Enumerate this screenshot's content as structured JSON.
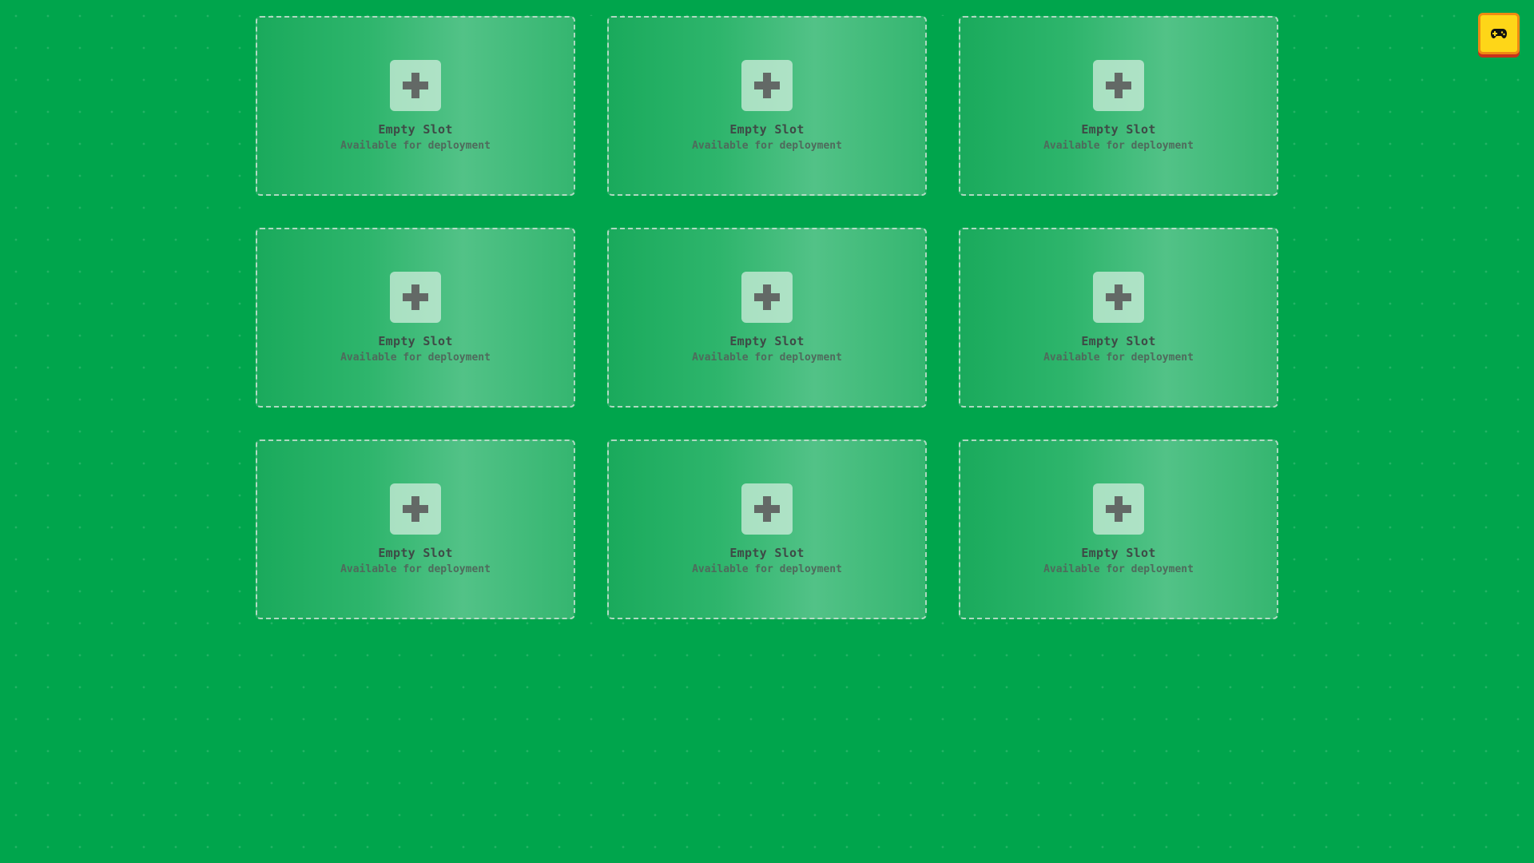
{
  "slots": [
    {
      "title": "Empty Slot",
      "subtitle": "Available for deployment"
    },
    {
      "title": "Empty Slot",
      "subtitle": "Available for deployment"
    },
    {
      "title": "Empty Slot",
      "subtitle": "Available for deployment"
    },
    {
      "title": "Empty Slot",
      "subtitle": "Available for deployment"
    },
    {
      "title": "Empty Slot",
      "subtitle": "Available for deployment"
    },
    {
      "title": "Empty Slot",
      "subtitle": "Available for deployment"
    },
    {
      "title": "Empty Slot",
      "subtitle": "Available for deployment"
    },
    {
      "title": "Empty Slot",
      "subtitle": "Available for deployment"
    },
    {
      "title": "Empty Slot",
      "subtitle": "Available for deployment"
    }
  ],
  "icons": {
    "slot_icon": "plus-icon",
    "corner_button_icon": "gamepad-icon"
  },
  "colors": {
    "background": "#00a54c",
    "corner_button": "#fed618",
    "corner_button_border": "#ef8a12",
    "corner_button_shadow": "#c8321c"
  }
}
